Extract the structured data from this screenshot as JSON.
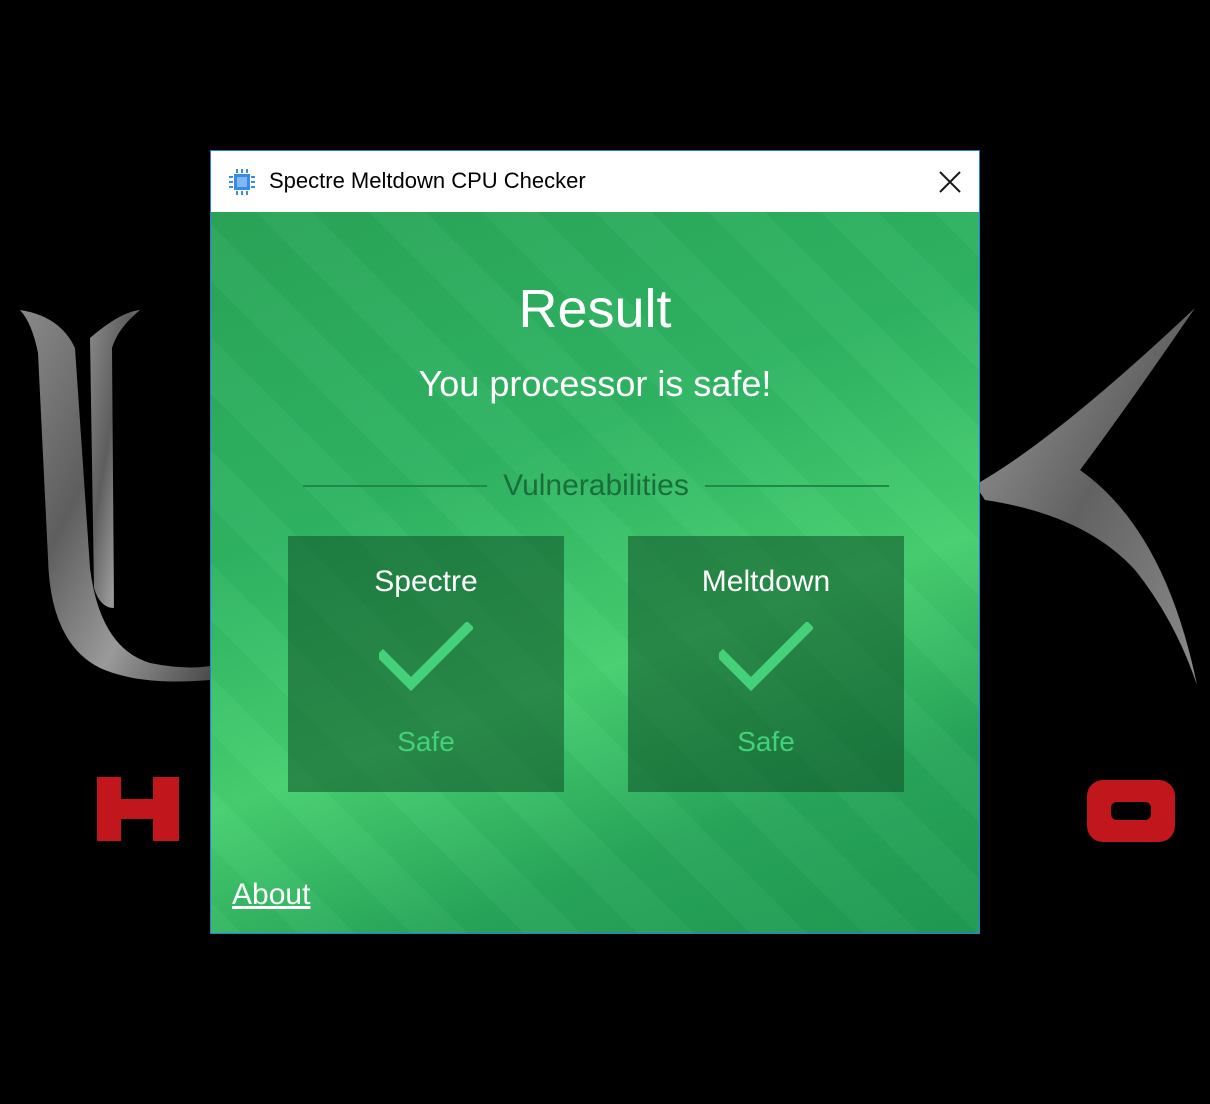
{
  "window": {
    "title": "Spectre Meltdown CPU Checker",
    "app_icon": "cpu-chip-icon",
    "close_icon": "close-icon"
  },
  "result": {
    "heading": "Result",
    "message": "You processor is safe!"
  },
  "vulnerabilities": {
    "label": "Vulnerabilities",
    "items": [
      {
        "name": "Spectre",
        "status": "Safe",
        "icon": "checkmark-icon"
      },
      {
        "name": "Meltdown",
        "status": "Safe",
        "icon": "checkmark-icon"
      }
    ]
  },
  "footer": {
    "about_link": "About"
  },
  "colors": {
    "window_green": "#2fb463",
    "safe_green": "#45d07a",
    "title_bar": "#ffffff",
    "window_border": "#2b7be4",
    "desktop_background": "#000000"
  }
}
